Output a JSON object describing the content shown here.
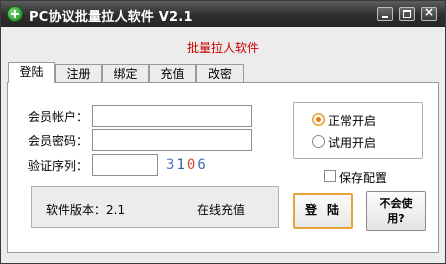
{
  "window": {
    "title": "PC协议批量拉人软件 V2.1",
    "icon": "plus-circle-icon"
  },
  "app": {
    "heading": "批量拉人软件"
  },
  "tabs": [
    {
      "label": "登陆",
      "active": true
    },
    {
      "label": "注册",
      "active": false
    },
    {
      "label": "绑定",
      "active": false
    },
    {
      "label": "充值",
      "active": false
    },
    {
      "label": "改密",
      "active": false
    }
  ],
  "login": {
    "account_label": "会员帐户：",
    "account_value": "",
    "password_label": "会员密码：",
    "password_value": "",
    "verify_label": "验证序列：",
    "verify_value": "",
    "captcha": [
      "3",
      "1",
      "0",
      "6"
    ]
  },
  "mode": {
    "options": [
      {
        "label": "正常开启",
        "checked": true
      },
      {
        "label": "试用开启",
        "checked": false
      }
    ]
  },
  "save_config": {
    "label": "保存配置",
    "checked": false
  },
  "info": {
    "version_label": "软件版本：2.1",
    "online_recharge": "在线充值"
  },
  "buttons": {
    "login": "登陆",
    "trial_line1": "不会使",
    "trial_line2": "用?"
  },
  "colors": {
    "heading": "#cc0000",
    "login_button_border": "#e8a23a",
    "titlebar": "#2d2d2d"
  }
}
